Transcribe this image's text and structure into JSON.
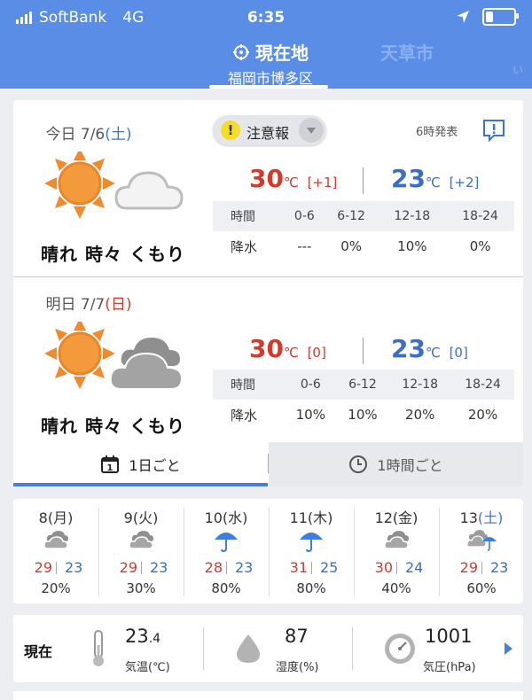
{
  "status": {
    "carrier": "SoftBank",
    "network": "4G",
    "time": "6:35"
  },
  "locations": {
    "active": {
      "name": "現在地",
      "sub": "福岡市博多区"
    },
    "other": "天草市",
    "dot": "い"
  },
  "today": {
    "label": "今日",
    "date": "7/6",
    "weekday": "(土)",
    "alert": "注意報",
    "issued": "6時発表",
    "desc": "晴れ 時々 くもり",
    "max": "30",
    "max_diff": "[+1]",
    "min": "23",
    "min_diff": "[+2]",
    "unit": "℃",
    "periods": [
      "0-6",
      "6-12",
      "12-18",
      "18-24"
    ],
    "time_label": "時間",
    "rain_label": "降水",
    "rain": [
      "---",
      "0%",
      "10%",
      "0%"
    ]
  },
  "tomorrow": {
    "label": "明日",
    "date": "7/7",
    "weekday": "(日)",
    "desc": "晴れ 時々 くもり",
    "max": "30",
    "max_diff": "[0]",
    "min": "23",
    "min_diff": "[0]",
    "unit": "℃",
    "periods": [
      "0-6",
      "6-12",
      "12-18",
      "18-24"
    ],
    "time_label": "時間",
    "rain_label": "降水",
    "rain": [
      "10%",
      "10%",
      "20%",
      "20%"
    ]
  },
  "tabs": {
    "daily": "1日ごと",
    "hourly": "1時間ごと",
    "calendar_num": "1"
  },
  "week": [
    {
      "day": "8",
      "wd": "(月)",
      "icon": "cloudy-icon",
      "hi": "29",
      "lo": "23",
      "pop": "20%"
    },
    {
      "day": "9",
      "wd": "(火)",
      "icon": "cloudy-icon",
      "hi": "29",
      "lo": "23",
      "pop": "30%"
    },
    {
      "day": "10",
      "wd": "(水)",
      "icon": "umbrella-icon",
      "hi": "28",
      "lo": "23",
      "pop": "80%"
    },
    {
      "day": "11",
      "wd": "(木)",
      "icon": "umbrella-icon",
      "hi": "31",
      "lo": "25",
      "pop": "80%"
    },
    {
      "day": "12",
      "wd": "(金)",
      "icon": "cloudy-icon",
      "hi": "30",
      "lo": "24",
      "pop": "40%"
    },
    {
      "day": "13",
      "wd": "(土)",
      "icon": "cloudy-rain-icon",
      "hi": "29",
      "lo": "23",
      "pop": "60%"
    }
  ],
  "current": {
    "label": "現在",
    "temp": "23",
    "temp_dec": ".4",
    "temp_label": "気温(℃)",
    "humidity": "87",
    "humidity_label": "湿度(%)",
    "pressure": "1001",
    "pressure_label": "気圧(hPa)"
  },
  "colors": {
    "header": "#5a8de6",
    "max": "#d23a2e",
    "min": "#3d6ec4",
    "accent": "#4a7fd9"
  }
}
